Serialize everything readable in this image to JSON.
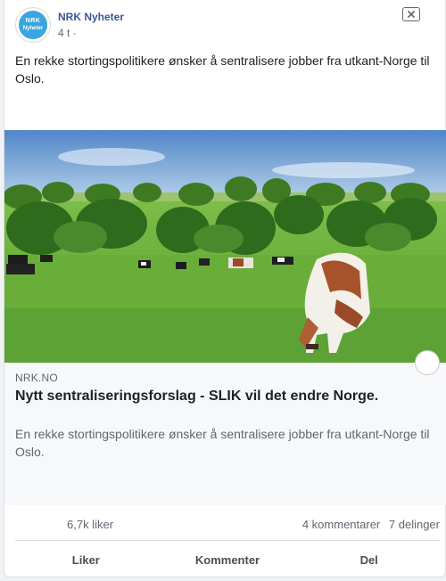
{
  "post": {
    "page_name": "NRK Nyheter",
    "avatar_line1": "NRK",
    "avatar_line2": "Nyheter",
    "time": "4 t",
    "time_separator": "·",
    "text": "En rekke stortingspolitikere ønsker å sentralisere jobber fra utkant-Norge til Oslo."
  },
  "link": {
    "domain": "NRK.NO",
    "title": "Nytt sentraliseringsforslag - SLIK vil det endre Norge.",
    "description": "En rekke stortingspolitikere ønsker å sentralisere jobber fra utkant-Norge til Oslo.",
    "image_alt": "cows-grazing-photo"
  },
  "stats": {
    "likes": "6,7k liker",
    "comments": "4 kommentarer",
    "shares": "7 delinger"
  },
  "actions": {
    "like": "Liker",
    "comment": "Kommenter",
    "share": "Del"
  },
  "colors": {
    "page_name": "#385898",
    "secondary_text": "#606770",
    "avatar_bg": "#3aa6e0",
    "link_bg": "#f7f8fa"
  },
  "icons": {
    "close": "close-icon"
  }
}
